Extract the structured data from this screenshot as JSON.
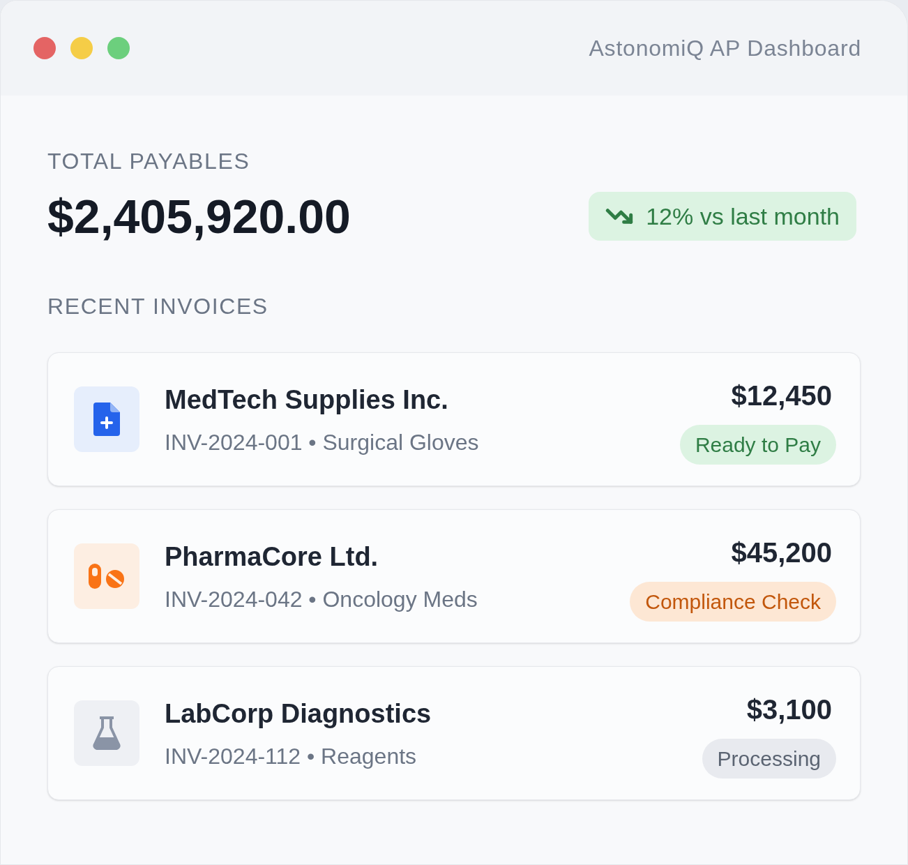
{
  "window": {
    "title": "AstonomiQ AP Dashboard"
  },
  "summary": {
    "label": "TOTAL PAYABLES",
    "amount": "$2,405,920.00",
    "trend": {
      "kind": "down",
      "text": "12% vs last month"
    }
  },
  "invoices_section": {
    "label": "RECENT INVOICES"
  },
  "invoices": [
    {
      "kind": "document",
      "vendor": "MedTech Supplies Inc.",
      "details": "INV-2024-001 • Surgical Gloves",
      "amount": "$12,450",
      "status": {
        "kind": "ready",
        "label": "Ready to Pay"
      }
    },
    {
      "kind": "pills",
      "vendor": "PharmaCore Ltd.",
      "details": "INV-2024-042 • Oncology Meds",
      "amount": "$45,200",
      "status": {
        "kind": "compliance",
        "label": "Compliance Check"
      }
    },
    {
      "kind": "flask",
      "vendor": "LabCorp Diagnostics",
      "details": "INV-2024-112 • Reagents",
      "amount": "$3,100",
      "status": {
        "kind": "processing",
        "label": "Processing"
      }
    }
  ]
}
